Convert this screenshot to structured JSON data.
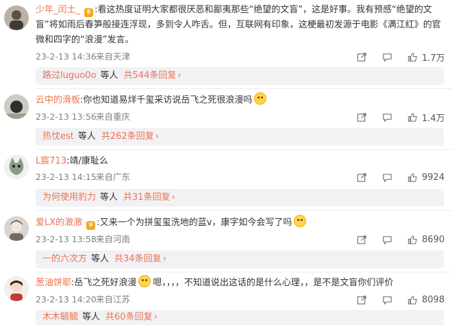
{
  "comments": [
    {
      "username": "少年_闰土_",
      "vip": true,
      "text": "看这热度证明大家都很厌恶和鄙夷那些“绝望的文盲”，这是好事。我有预感“绝望的文盲”将如雨后春笋般接连浮现，多到令人咋舌。但，互联网有印象，这梗最初发源于电影《满江红》的官微和四字的“浪漫”发言。",
      "emoji_after": false,
      "date": "23-2-13 14:36",
      "location": "来自天津",
      "likes": "1.7万",
      "reply": {
        "user": "路过luguo0o",
        "etc": "等人",
        "count": "共544条回复"
      }
    },
    {
      "username": "云中的滑板",
      "vip": false,
      "text": "你也知道易烊千玺采访说岳飞之死很浪漫吗",
      "emoji_after": true,
      "date": "23-2-13 13:56",
      "location": "来自重庆",
      "likes": "1.4万",
      "reply": {
        "user": "热忱est",
        "etc": "等人",
        "count": "共262条回复"
      }
    },
    {
      "username": "L宸713",
      "vip": false,
      "text": "靖/康耻么",
      "emoji_after": false,
      "date": "23-2-13 14:15",
      "location": "来自广东",
      "likes": "9924",
      "reply": {
        "user": "为何使用豹力",
        "etc": "等人",
        "count": "共31条回复"
      }
    },
    {
      "username": "爱LX的澈澈",
      "vip": true,
      "text": "又来一个为拼玺玺洗地的蓝v，康字如今会写了吗",
      "emoji_after": true,
      "date": "23-2-13 13:58",
      "location": "来自河南",
      "likes": "8690",
      "reply": {
        "user": "一的六次方",
        "etc": "等人",
        "count": "共34条回复"
      }
    },
    {
      "username": "葱油饼耶",
      "vip": false,
      "text_a": "岳飞之死好浪漫",
      "text_b": "嗯，，，，不知道说出这话的是什么心理，，是不是文盲你们评价",
      "emoji_after": false,
      "date": "23-2-13 14:20",
      "location": "来自江苏",
      "likes": "8098",
      "reply": {
        "user": "木木毓毓",
        "etc": "等人",
        "count": "共60条回复"
      }
    }
  ],
  "icons": {
    "share": "share-icon",
    "comment": "comment-icon",
    "like": "like-icon"
  },
  "colors": {
    "username": "#eb7350",
    "meta": "#808080",
    "reply_bg": "#f2f2f5"
  }
}
